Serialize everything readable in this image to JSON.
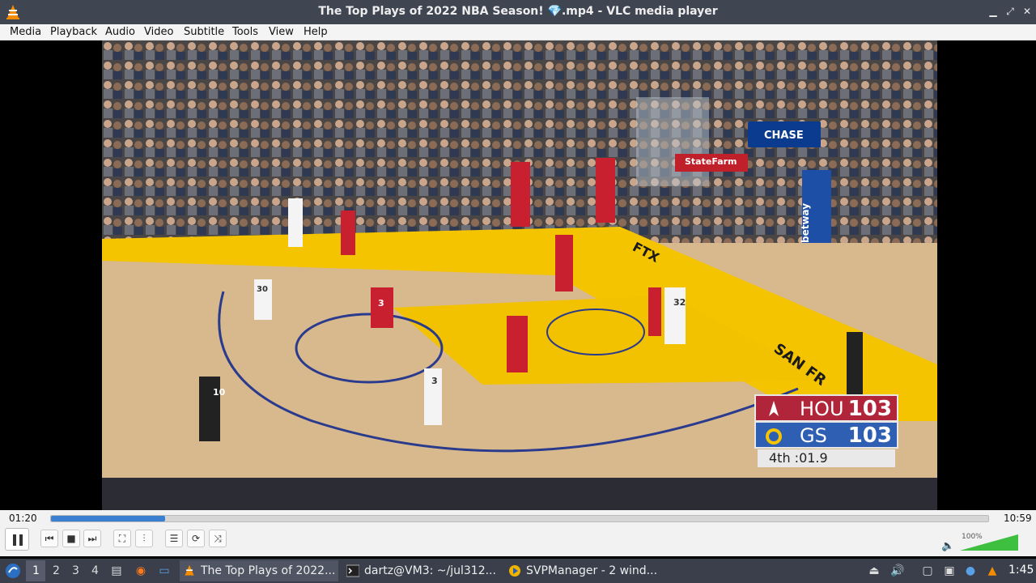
{
  "window": {
    "title": "The Top Plays of 2022 NBA Season! 💎.mp4 - VLC media player"
  },
  "menu": [
    "Media",
    "Playback",
    "Audio",
    "Video",
    "Subtitle",
    "Tools",
    "View",
    "Help"
  ],
  "video": {
    "scoreboard": {
      "home_team": "HOU",
      "home_score": "103",
      "away_team": "GS",
      "away_score": "103",
      "clock": "4th  :01.9"
    },
    "court_signs": {
      "chase": "CHASE",
      "statefarm": "StateFarm",
      "betway": "betway",
      "ftx": "FTX",
      "sanfr": "SAN FR"
    },
    "jerseys": {
      "p30": "30",
      "p3": "3",
      "p32": "32",
      "p10": "10",
      "p3w": "3"
    }
  },
  "controls": {
    "elapsed": "01:20",
    "duration": "10:59",
    "progress": 0.122,
    "volume_label": "100%",
    "volume": 1.0
  },
  "taskbar": {
    "workspaces": [
      "1",
      "2",
      "3",
      "4"
    ],
    "active_workspace": "1",
    "tasks": [
      {
        "label": "The Top Plays of 2022...",
        "icon": "vlc-icon",
        "active": true
      },
      {
        "label": "dartz@VM3: ~/jul312...",
        "icon": "terminal-icon",
        "active": false
      },
      {
        "label": "SVPManager - 2 wind...",
        "icon": "svp-icon",
        "active": false
      }
    ],
    "clock": "1:45"
  },
  "colors": {
    "titlebar": "#404552",
    "taskbar": "#3a3f4b",
    "seek_fill": "#3a7fd0",
    "rockets_red": "#b1253a",
    "warriors_blue": "#2e5fb3",
    "court_yellow": "#f5c400"
  }
}
